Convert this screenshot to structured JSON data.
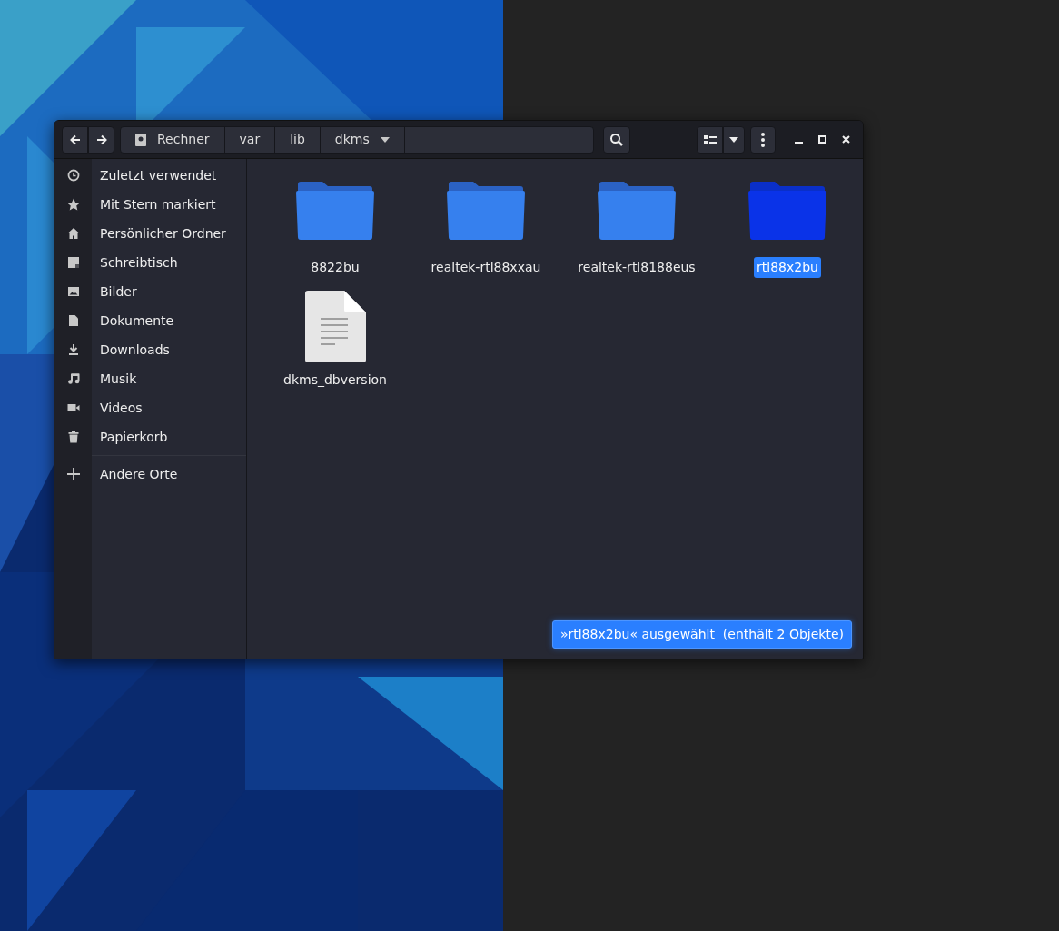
{
  "path_bar": [
    {
      "label": "Rechner",
      "kind": "drive"
    },
    {
      "label": "var",
      "kind": "folder"
    },
    {
      "label": "lib",
      "kind": "folder"
    },
    {
      "label": "dkms",
      "kind": "current"
    }
  ],
  "sidebar": {
    "items": [
      {
        "label": "Zuletzt verwendet"
      },
      {
        "label": "Mit Stern markiert"
      },
      {
        "label": "Persönlicher Ordner"
      },
      {
        "label": "Schreibtisch"
      },
      {
        "label": "Bilder"
      },
      {
        "label": "Dokumente"
      },
      {
        "label": "Downloads"
      },
      {
        "label": "Musik"
      },
      {
        "label": "Videos"
      },
      {
        "label": "Papierkorb"
      }
    ],
    "other_places": "Andere Orte"
  },
  "files": [
    {
      "name": "8822bu",
      "kind": "folder",
      "selected": false
    },
    {
      "name": "realtek-rtl88xxau",
      "kind": "folder",
      "selected": false
    },
    {
      "name": "realtek-rtl8188eus",
      "kind": "folder",
      "selected": false
    },
    {
      "name": "rtl88x2bu",
      "kind": "folder",
      "selected": true
    },
    {
      "name": "dkms_dbversion",
      "kind": "file",
      "selected": false
    }
  ],
  "status": "»rtl88x2bu« ausgewählt  (enthält 2 Objekte)"
}
